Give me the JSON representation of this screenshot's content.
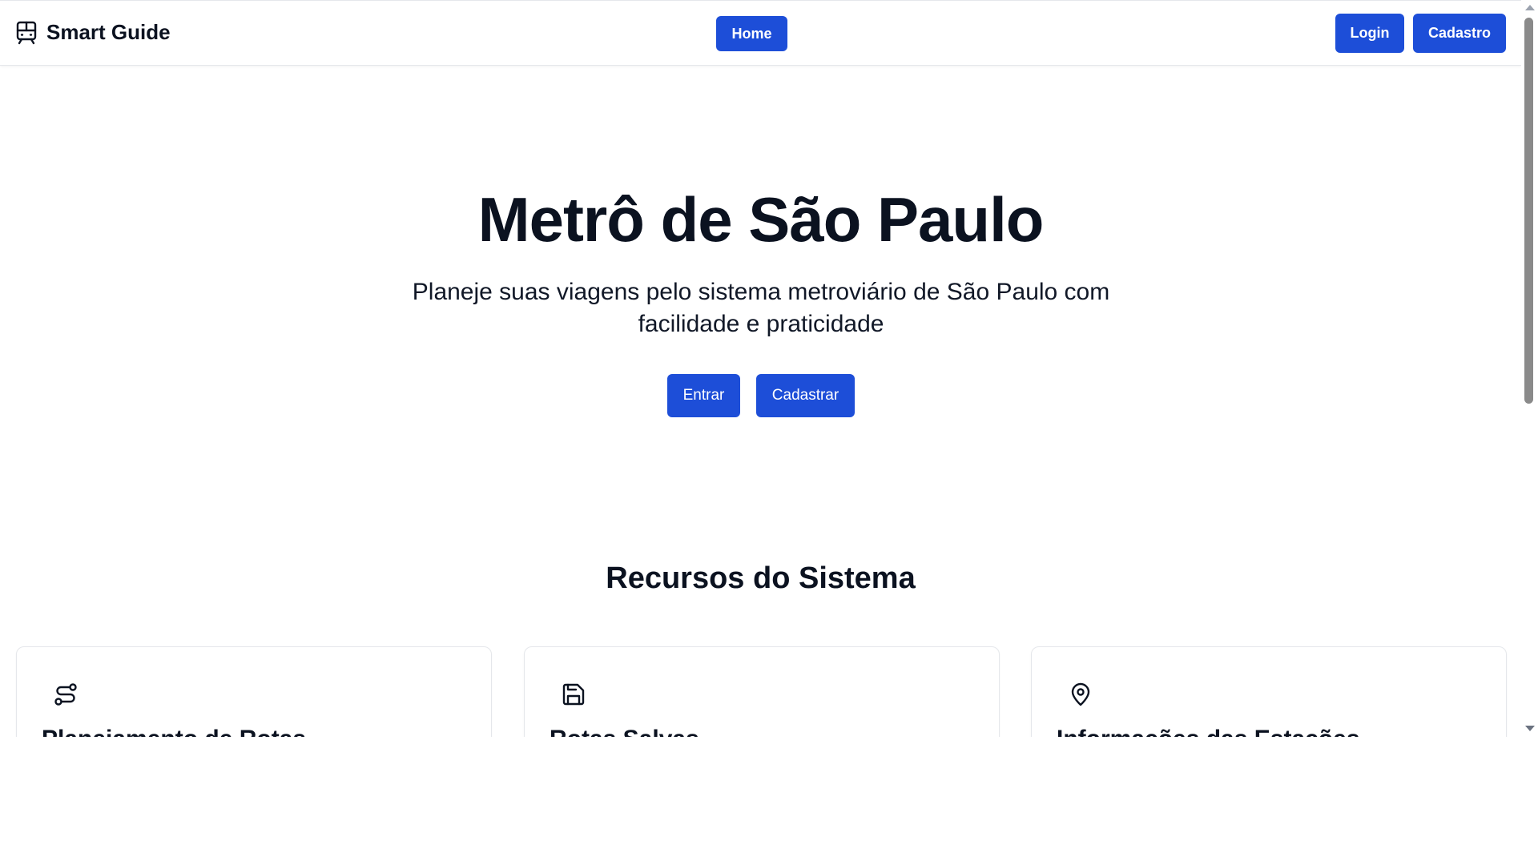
{
  "navbar": {
    "brand_name": "Smart Guide",
    "brand_icon": "train-icon",
    "home_label": "Home",
    "login_label": "Login",
    "cadastro_label": "Cadastro"
  },
  "hero": {
    "title": "Metrô de São Paulo",
    "subtitle": "Planeje suas viagens pelo sistema metroviário de São Paulo com facilidade e praticidade",
    "entrar_label": "Entrar",
    "cadastrar_label": "Cadastrar"
  },
  "features": {
    "title": "Recursos do Sistema",
    "cards": [
      {
        "icon": "route-icon",
        "title": "Planejamento de Rotas"
      },
      {
        "icon": "save-icon",
        "title": "Rotas Salvas"
      },
      {
        "icon": "map-pin-icon",
        "title": "Informações das Estações"
      }
    ]
  },
  "colors": {
    "primary": "#1d4ed8",
    "text": "#0b1220",
    "border": "#e5e7eb"
  }
}
